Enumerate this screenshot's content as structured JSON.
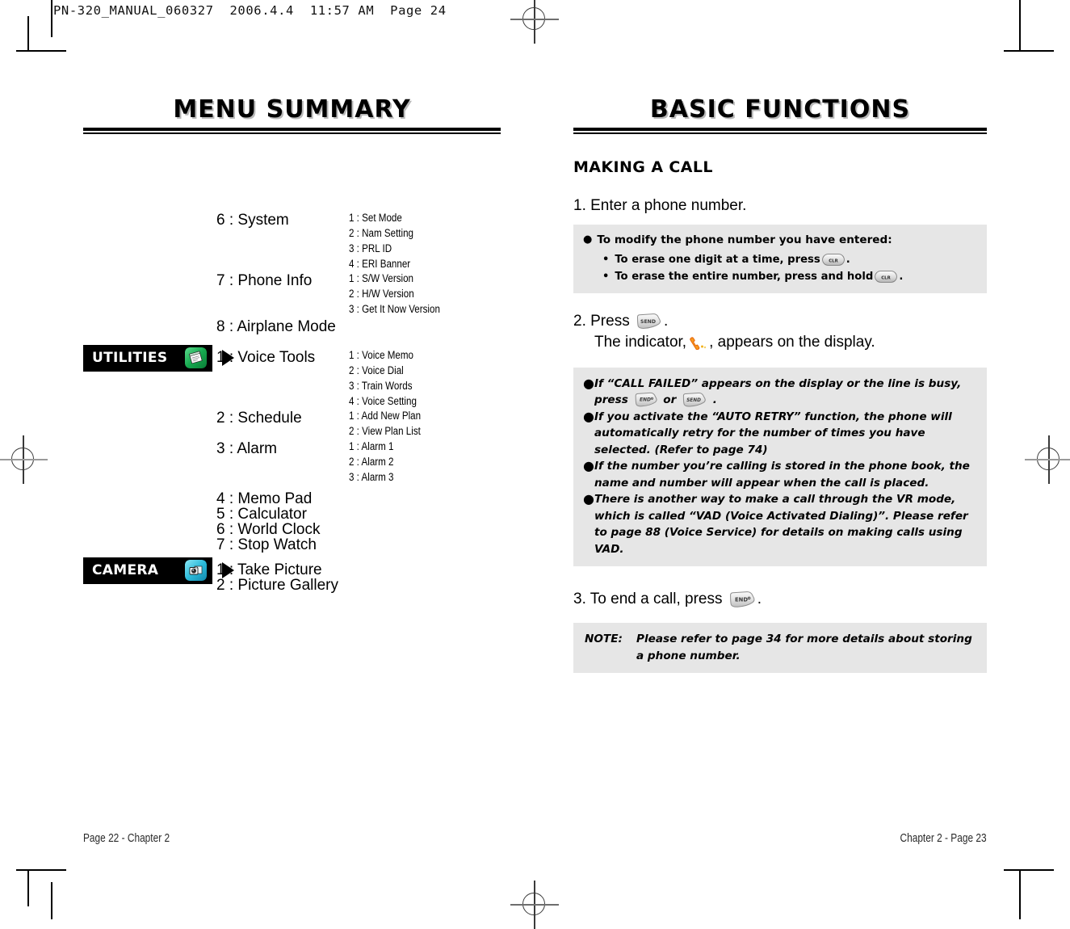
{
  "prepress": {
    "slug": "PN-320_MANUAL_060327  2006.4.4  11:57 AM  Page 24"
  },
  "left_page": {
    "section_title": "MENU SUMMARY",
    "menu_groups": [
      {
        "label": "6 : System",
        "subs": [
          "1 : Set Mode",
          "2 : Nam Setting",
          "3 : PRL ID",
          "4 : ERI Banner"
        ]
      },
      {
        "label": "7 : Phone Info",
        "subs": [
          "1 : S/W Version",
          "2 : H/W Version",
          "3 : Get It Now Version"
        ]
      },
      {
        "label": "8 : Airplane Mode",
        "subs": []
      },
      {
        "label": "1 : Voice Tools",
        "subs": [
          "1 : Voice Memo",
          "2 : Voice Dial",
          "3 : Train Words",
          "4 : Voice Setting"
        ]
      },
      {
        "label": "2 : Schedule",
        "subs": [
          "1 : Add New Plan",
          "2 : View Plan List"
        ]
      },
      {
        "label": "3 : Alarm",
        "subs": [
          "1 : Alarm 1",
          "2 : Alarm 2",
          "3 : Alarm 3"
        ]
      },
      {
        "label": "4 : Memo Pad",
        "subs": []
      },
      {
        "label": "5 : Calculator",
        "subs": []
      },
      {
        "label": "6 : World Clock",
        "subs": []
      },
      {
        "label": "7 : Stop Watch",
        "subs": []
      },
      {
        "label": "1 : Take Picture",
        "subs": []
      },
      {
        "label": "2 : Picture Gallery",
        "subs": []
      }
    ],
    "categories": [
      {
        "name": "UTILITIES",
        "icon": "notepad-icon",
        "color": "#12a04a"
      },
      {
        "name": "CAMERA",
        "icon": "camera-icon",
        "color": "#28b8d8"
      }
    ],
    "footer": "Page 22 - Chapter 2"
  },
  "right_page": {
    "section_title": "BASIC FUNCTIONS",
    "sub_head": "MAKING A CALL",
    "step1": {
      "text": "1. Enter a phone number.",
      "box": {
        "heading": "To modify the phone number you have entered:",
        "items": [
          {
            "before": "To erase one digit at a time, press",
            "key": "CLR",
            "after": "."
          },
          {
            "before": "To erase the entire number, press and hold",
            "key": "CLR",
            "after": "."
          }
        ]
      }
    },
    "step2": {
      "line1_before": "2. Press",
      "line1_key": "SEND",
      "line1_after": ".",
      "line2_before": "The indicator,",
      "line2_icon": "phone-handset-icon",
      "line2_after": ", appears on the display.",
      "box": {
        "notes": [
          {
            "segments": [
              {
                "t": "If “CALL FAILED” appears on the display or the line is busy, press "
              },
              {
                "key": "END"
              },
              {
                "t": " or "
              },
              {
                "key": "SEND"
              },
              {
                "t": " ."
              }
            ]
          },
          {
            "segments": [
              {
                "t": "If you activate the “AUTO RETRY” function, the phone will automatically retry for the number of times you have selected. (Refer to page 74)"
              }
            ]
          },
          {
            "segments": [
              {
                "t": "If the number you’re calling is stored in the phone book, the name and number will appear when the call is placed."
              }
            ]
          },
          {
            "segments": [
              {
                "t": "There is another way to make a call through the VR mode, which is called “VAD (Voice Activated Dialing)”. Please refer to page 88 (Voice Service) for details on making calls using VAD."
              }
            ]
          }
        ]
      }
    },
    "step3": {
      "before": "3. To end a call, press",
      "key": "END",
      "after": ".",
      "note": {
        "label": "NOTE:",
        "text": "Please refer to page 34 for more details about storing a phone number."
      }
    },
    "footer": "Chapter 2 - Page 23"
  },
  "symbols": {
    "bullet_dot": "●",
    "bullet_square": "•",
    "key_clr": "CLR",
    "key_send": "SEND",
    "key_end": "END"
  }
}
